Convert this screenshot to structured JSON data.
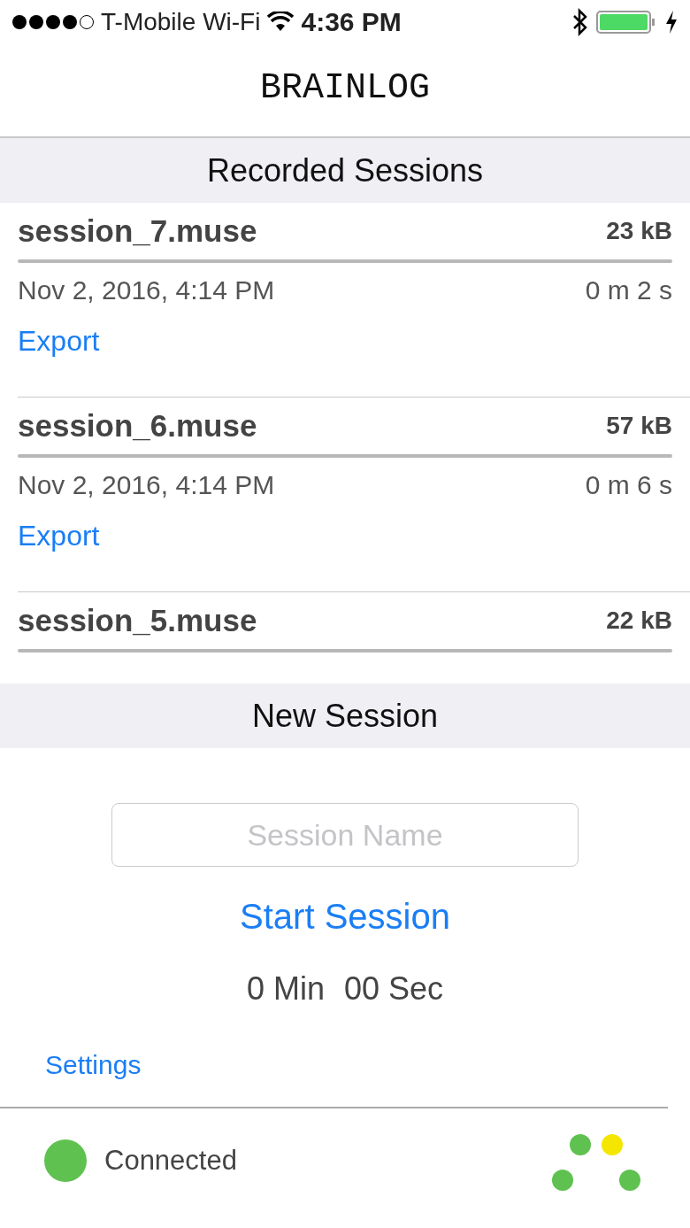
{
  "status_bar": {
    "carrier": "T-Mobile Wi-Fi",
    "time": "4:36 PM"
  },
  "title": "BRAINLOG",
  "recorded_header": "Recorded Sessions",
  "sessions": [
    {
      "name": "session_7.muse",
      "size": "23 kB",
      "date": "Nov 2, 2016, 4:14 PM",
      "duration": "0 m 2 s",
      "action": "Export"
    },
    {
      "name": "session_6.muse",
      "size": "57 kB",
      "date": "Nov 2, 2016, 4:14 PM",
      "duration": "0 m 6 s",
      "action": "Export"
    },
    {
      "name": "session_5.muse",
      "size": "22 kB"
    }
  ],
  "new_header": "New Session",
  "session_field": {
    "placeholder": "Session Name"
  },
  "start_button": "Start Session",
  "timer": {
    "minutes": "0 Min",
    "seconds": "00 Sec"
  },
  "settings_link": "Settings",
  "connection": {
    "label": "Connected",
    "color": "#5fc150"
  },
  "sensors": [
    {
      "color": "#5fc150"
    },
    {
      "color": "#f5e600"
    },
    {
      "color": "#5fc150"
    },
    {
      "color": "#5fc150"
    }
  ]
}
